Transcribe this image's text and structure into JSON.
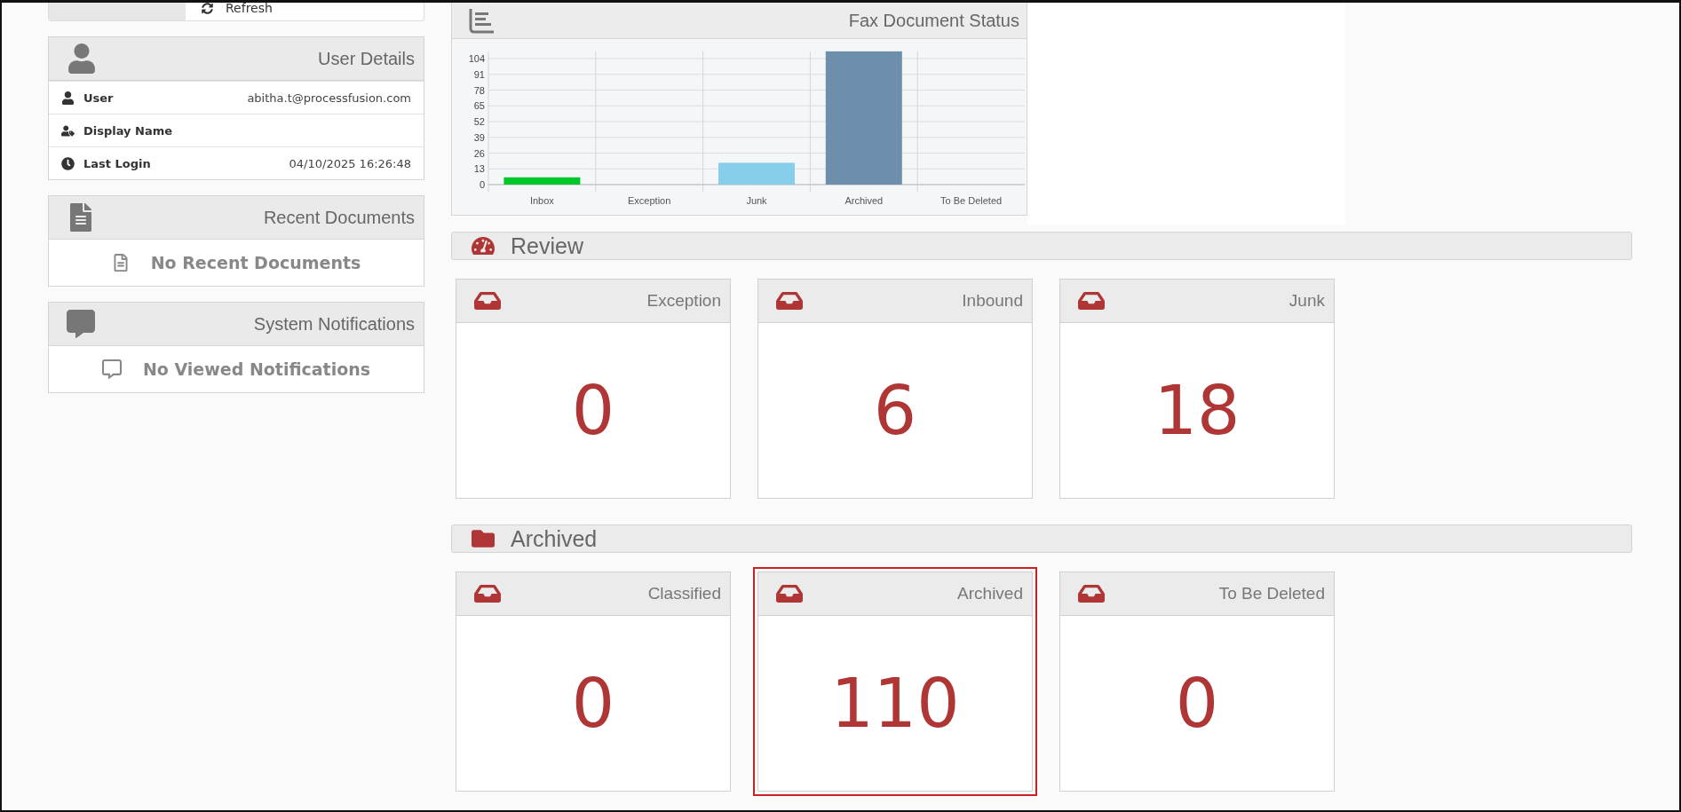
{
  "refresh_panel": {
    "button": "Refresh"
  },
  "user_details": {
    "title": "User Details",
    "rows": [
      {
        "kind": "user",
        "label": "User",
        "value": "abitha.t@processfusion.com"
      },
      {
        "kind": "display_name",
        "label": "Display Name"
      },
      {
        "kind": "last_login",
        "label": "Last Login",
        "value": "04/10/2025 16:26:48"
      }
    ]
  },
  "recent_documents": {
    "title": "Recent Documents",
    "empty_text": "No Recent Documents"
  },
  "system_notifications": {
    "title": "System Notifications",
    "empty_text": "No Viewed Notifications"
  },
  "fax_status": {
    "title": "Fax Document Status",
    "chart_data": {
      "type": "bar",
      "categories": [
        "Inbox",
        "Exception",
        "Junk",
        "Archived",
        "To Be Deleted"
      ],
      "values": [
        6,
        0,
        18,
        110,
        0
      ],
      "colors": [
        "#00c82a",
        null,
        "#87ceeb",
        "#6e8fab",
        null
      ],
      "ylim": [
        0,
        110
      ],
      "grid": true,
      "yticks": [
        0,
        13,
        26,
        39,
        52,
        65,
        78,
        91,
        104
      ]
    }
  },
  "sections": [
    {
      "kind": "review",
      "title": "Review",
      "cards": [
        {
          "title": "Exception",
          "count": "0",
          "selected": false
        },
        {
          "title": "Inbound",
          "count": "6",
          "selected": false
        },
        {
          "title": "Junk",
          "count": "18",
          "selected": false
        }
      ]
    },
    {
      "kind": "archived",
      "title": "Archived",
      "cards": [
        {
          "title": "Classified",
          "count": "0",
          "selected": false
        },
        {
          "title": "Archived",
          "count": "110",
          "selected": true
        },
        {
          "title": "To Be Deleted",
          "count": "0",
          "selected": false
        }
      ]
    }
  ]
}
